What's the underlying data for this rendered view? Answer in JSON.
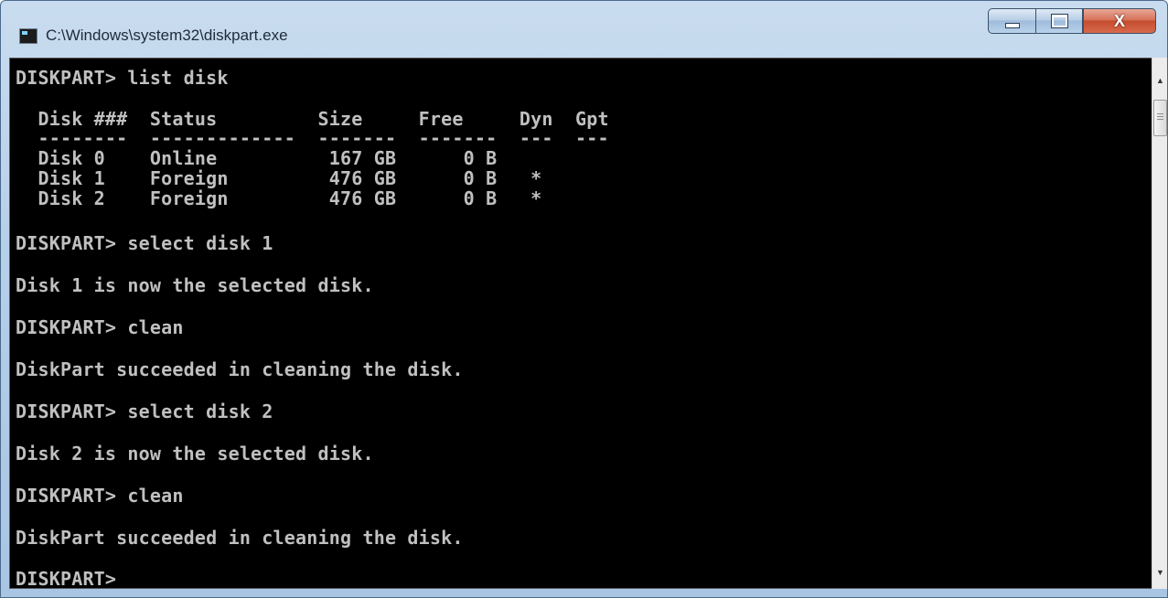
{
  "window": {
    "title": "C:\\Windows\\system32\\diskpart.exe",
    "close_glyph": "X"
  },
  "console": {
    "lines": [
      "DISKPART> list disk",
      "  Disk ###  Status         Size     Free     Dyn  Gpt",
      "  --------  -------------  -------  -------  ---  ---",
      "  Disk 0    Online          167 GB      0 B",
      "  Disk 1    Foreign         476 GB      0 B   *",
      "  Disk 2    Foreign         476 GB      0 B   *",
      "DISKPART> select disk 1",
      "Disk 1 is now the selected disk.",
      "DISKPART> clean",
      "DiskPart succeeded in cleaning the disk.",
      "DISKPART> select disk 2",
      "Disk 2 is now the selected disk.",
      "DISKPART> clean",
      "DiskPart succeeded in cleaning the disk.",
      "DISKPART>"
    ]
  },
  "icons": {
    "app": "console-app-icon",
    "minimize": "minimize-icon",
    "maximize": "maximize-icon",
    "close": "close-icon",
    "scroll_up": "scroll-up-arrow-icon",
    "scroll_down": "scroll-down-arrow-icon"
  },
  "colors": {
    "console_bg": "#000000",
    "console_text": "#c0c0c0",
    "close_button": "#c44d2f"
  }
}
